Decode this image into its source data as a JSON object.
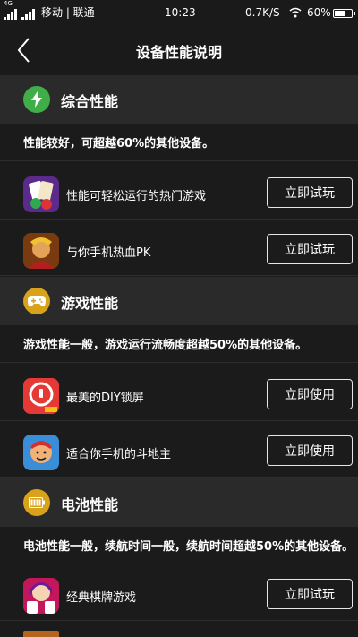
{
  "status_bar": {
    "network_type": "4G",
    "carrier": "移动 | 联通",
    "time": "10:23",
    "net_speed": "0.7K/S",
    "battery": "60%"
  },
  "header": {
    "title": "设备性能说明"
  },
  "sections": [
    {
      "title": "综合性能",
      "icon": "lightning-icon",
      "icon_color": "#3fae49",
      "description": "性能较好，可超越60%的其他设备。",
      "items": [
        {
          "label": "性能可轻松运行的热门游戏",
          "button": "立即试玩",
          "icon": "poker-game-icon"
        },
        {
          "label": "与你手机热血PK",
          "button": "立即试玩",
          "icon": "warrior-game-icon"
        }
      ]
    },
    {
      "title": "游戏性能",
      "icon": "gamepad-icon",
      "icon_color": "#d9a21b",
      "description": "游戏性能一般，游戏运行流畅度超越50%的其他设备。",
      "items": [
        {
          "label": "最美的DIY锁屏",
          "button": "立即使用",
          "icon": "lock-screen-app-icon"
        },
        {
          "label": "适合你手机的斗地主",
          "button": "立即使用",
          "icon": "doudizhu-game-icon"
        }
      ]
    },
    {
      "title": "电池性能",
      "icon": "battery-icon",
      "icon_color": "#d9a21b",
      "description": "电池性能一般，续航时间一般，续航时间超越50%的其他设备。",
      "items": [
        {
          "label": "经典棋牌游戏",
          "button": "立即试玩",
          "icon": "card-game-icon"
        }
      ]
    }
  ]
}
